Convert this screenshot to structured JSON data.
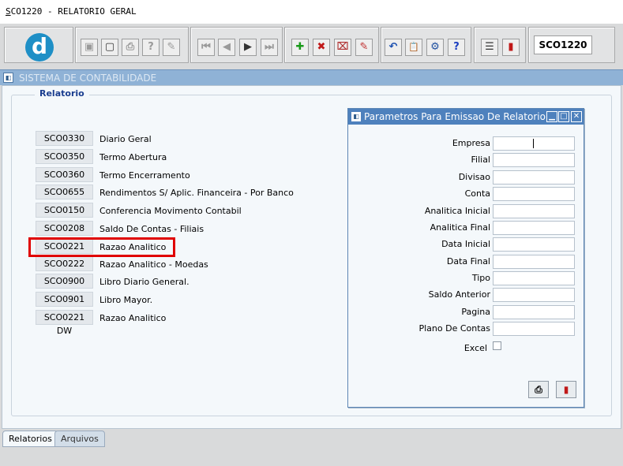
{
  "window": {
    "title_underlined": "S",
    "title_rest": "CO1220 - RELATORIO GERAL"
  },
  "toolbar": {
    "logo_letter": "d",
    "buttons": [
      {
        "name": "save-button",
        "icon": "floppy-icon",
        "glyph": "▣",
        "enabled": false
      },
      {
        "name": "screen-button",
        "icon": "monitor-icon",
        "glyph": "▢",
        "enabled": true
      },
      {
        "name": "print-button",
        "icon": "printer-icon",
        "glyph": "⎙",
        "enabled": false
      },
      {
        "name": "query-button",
        "icon": "query-icon",
        "glyph": "?",
        "enabled": false
      },
      {
        "name": "run-query-button",
        "icon": "pencil-icon",
        "glyph": "✎",
        "enabled": false
      },
      {
        "name": "first-record-button",
        "icon": "first-icon",
        "glyph": "⏮",
        "enabled": false
      },
      {
        "name": "previous-record-button",
        "icon": "previous-icon",
        "glyph": "◀",
        "enabled": false
      },
      {
        "name": "next-record-button",
        "icon": "next-icon",
        "glyph": "▶",
        "enabled": true
      },
      {
        "name": "last-record-button",
        "icon": "last-icon",
        "glyph": "⏭",
        "enabled": false
      },
      {
        "name": "add-record-button",
        "icon": "plus-icon",
        "glyph": "✚",
        "enabled": true
      },
      {
        "name": "delete-record-button",
        "icon": "delete-icon",
        "glyph": "✖",
        "enabled": true
      },
      {
        "name": "clear-record-button",
        "icon": "clear-icon",
        "glyph": "⌧",
        "enabled": true
      },
      {
        "name": "edit-record-button",
        "icon": "edit-icon",
        "glyph": "✎",
        "enabled": true
      },
      {
        "name": "undo-button",
        "icon": "undo-icon",
        "glyph": "↶",
        "enabled": true
      },
      {
        "name": "clipboard-button",
        "icon": "clipboard-icon",
        "glyph": "📋",
        "enabled": false
      },
      {
        "name": "tools-button",
        "icon": "tools-icon",
        "glyph": "⚙",
        "enabled": true
      },
      {
        "name": "help-button",
        "icon": "help-icon",
        "glyph": "?",
        "enabled": true
      },
      {
        "name": "menu-button",
        "icon": "menu-icon",
        "glyph": "☰",
        "enabled": true
      },
      {
        "name": "exit-button",
        "icon": "exit-door-icon",
        "glyph": "▮",
        "enabled": true
      }
    ],
    "screen_code": "SCO1220"
  },
  "system_bar": {
    "title": "SISTEMA DE CONTABILIDADE"
  },
  "reports_group": {
    "label": "Relatorio",
    "items": [
      {
        "code": "SCO0330",
        "label": "Diario Geral"
      },
      {
        "code": "SCO0350",
        "label": "Termo Abertura"
      },
      {
        "code": "SCO0360",
        "label": "Termo Encerramento"
      },
      {
        "code": "SCO0655",
        "label": "Rendimentos S/ Aplic. Financeira - Por Banco"
      },
      {
        "code": "SCO0150",
        "label": "Conferencia Movimento Contabil"
      },
      {
        "code": "SCO0208",
        "label": "Saldo De Contas - Filiais"
      },
      {
        "code": "SCO0221",
        "label": "Razao Analitico"
      },
      {
        "code": "SCO0222",
        "label": "Razao Analitico - Moedas"
      },
      {
        "code": "SCO0900",
        "label": "Libro Diario General."
      },
      {
        "code": "SCO0901",
        "label": "Libro Mayor."
      },
      {
        "code": "SCO0221 DW",
        "label": "Razao Analitico"
      }
    ]
  },
  "dialog": {
    "title": "Parametros Para Emissao De Relatorio",
    "fields": [
      {
        "label": "Empresa",
        "value": ""
      },
      {
        "label": "Filial",
        "value": ""
      },
      {
        "label": "Divisao",
        "value": ""
      },
      {
        "label": "Conta",
        "value": ""
      },
      {
        "label": "Analitica Inicial",
        "value": ""
      },
      {
        "label": "Analitica Final",
        "value": ""
      },
      {
        "label": "Data Inicial",
        "value": ""
      },
      {
        "label": "Data Final",
        "value": ""
      },
      {
        "label": "Tipo",
        "value": ""
      },
      {
        "label": "Saldo Anterior",
        "value": ""
      },
      {
        "label": "Pagina",
        "value": ""
      },
      {
        "label": "Plano De Contas",
        "value": ""
      }
    ],
    "excel_label": "Excel",
    "excel_checked": false
  },
  "tabs": [
    {
      "label": "Relatorios",
      "active": true
    },
    {
      "label": "Arquivos",
      "active": false
    }
  ],
  "colors": {
    "highlight": "#e00000",
    "dialog_title": "#4e81bd",
    "system_bar": "#8fb2d6",
    "group_label": "#1a3d8f"
  }
}
